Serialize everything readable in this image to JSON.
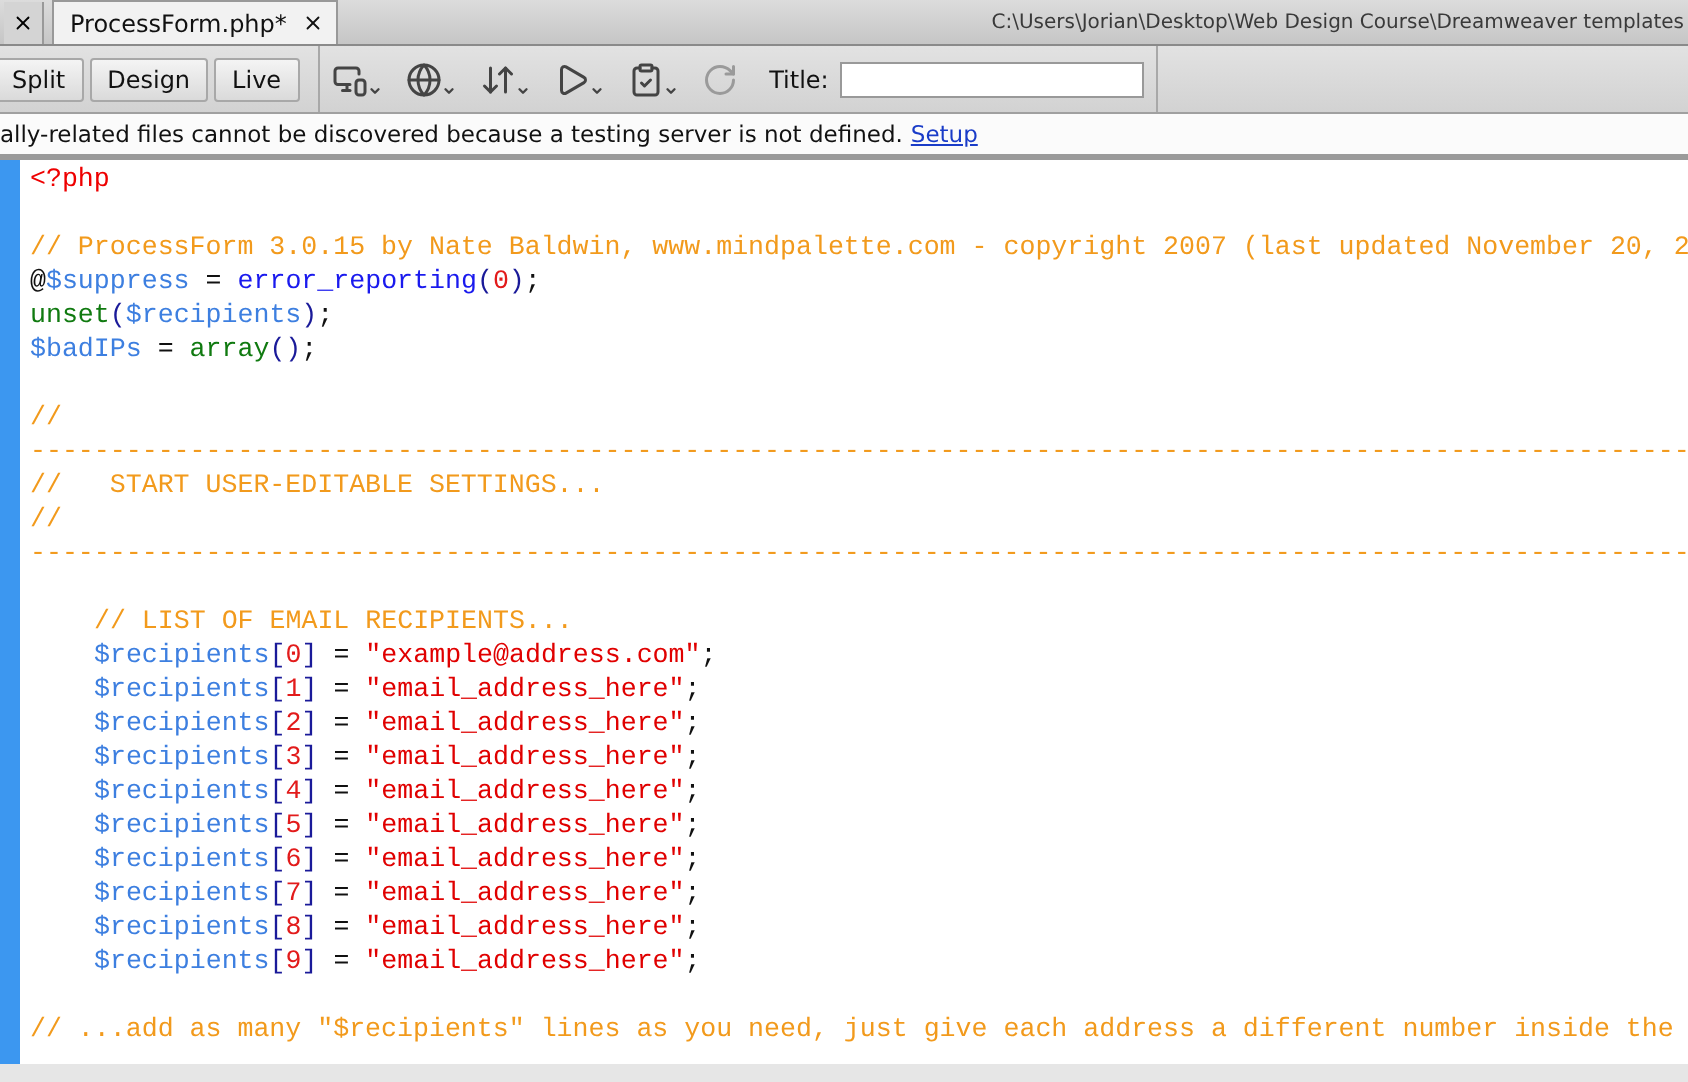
{
  "tabs": [
    {
      "label": "ProcessForm.php*",
      "selected": true
    }
  ],
  "file_path": "C:\\Users\\Jorian\\Desktop\\Web Design Course\\Dreamweaver templates",
  "view_buttons": [
    "Split",
    "Design",
    "Live"
  ],
  "toolbar_icons": [
    {
      "kind": "devices"
    },
    {
      "kind": "globe"
    },
    {
      "kind": "transfer"
    },
    {
      "kind": "visual-aids"
    },
    {
      "kind": "check-page"
    },
    {
      "kind": "refresh",
      "disabled": true
    }
  ],
  "title_field": {
    "label": "Title:"
  },
  "info_bar": {
    "message": "ally-related files cannot be discovered because a testing server is not defined.",
    "link": "Setup"
  },
  "code_blocks": [
    [
      {
        "tokens": [
          {
            "kind": "tag",
            "text": "<?php"
          }
        ]
      }
    ],
    [
      {
        "tokens": [
          {
            "kind": "comment",
            "text": "// ProcessForm 3.0.15 by Nate Baldwin, www.mindpalette.com - copyright 2007 (last updated November 20, 2"
          }
        ]
      },
      {
        "tokens": [
          {
            "kind": "plain",
            "text": "@"
          },
          {
            "kind": "variable",
            "text": "$suppress"
          },
          {
            "kind": "plain",
            "text": " = "
          },
          {
            "kind": "function",
            "text": "error_reporting"
          },
          {
            "kind": "bracket",
            "text": "("
          },
          {
            "kind": "number",
            "text": "0"
          },
          {
            "kind": "bracket",
            "text": ")"
          },
          {
            "kind": "plain",
            "text": ";"
          }
        ]
      },
      {
        "tokens": [
          {
            "kind": "builtin",
            "text": "unset"
          },
          {
            "kind": "bracket",
            "text": "("
          },
          {
            "kind": "variable",
            "text": "$recipients"
          },
          {
            "kind": "bracket",
            "text": ")"
          },
          {
            "kind": "plain",
            "text": ";"
          }
        ]
      },
      {
        "tokens": [
          {
            "kind": "variable",
            "text": "$badIPs"
          },
          {
            "kind": "plain",
            "text": " = "
          },
          {
            "kind": "builtin",
            "text": "array"
          },
          {
            "kind": "bracket",
            "text": "()"
          },
          {
            "kind": "plain",
            "text": ";"
          }
        ]
      }
    ],
    [
      {
        "tokens": [
          {
            "kind": "comment",
            "text": "//"
          }
        ]
      },
      {
        "tokens": [
          {
            "kind": "comment",
            "text": "--------------------------------------------------------------------------------------------------------"
          }
        ]
      },
      {
        "tokens": [
          {
            "kind": "comment",
            "text": "//   START USER-EDITABLE SETTINGS..."
          }
        ]
      },
      {
        "tokens": [
          {
            "kind": "comment",
            "text": "//"
          }
        ]
      },
      {
        "tokens": [
          {
            "kind": "comment",
            "text": "--------------------------------------------------------------------------------------------------------"
          }
        ]
      }
    ],
    [
      {
        "indent": true,
        "tokens": [
          {
            "kind": "comment",
            "text": "// LIST OF EMAIL RECIPIENTS..."
          }
        ]
      },
      {
        "indent": true,
        "tokens": [
          {
            "kind": "variable",
            "text": "$recipients"
          },
          {
            "kind": "bracket",
            "text": "["
          },
          {
            "kind": "number",
            "text": "0"
          },
          {
            "kind": "bracket",
            "text": "]"
          },
          {
            "kind": "plain",
            "text": " = "
          },
          {
            "kind": "string",
            "text": "\"example@address.com\""
          },
          {
            "kind": "plain",
            "text": ";"
          }
        ]
      },
      {
        "indent": true,
        "tokens": [
          {
            "kind": "variable",
            "text": "$recipients"
          },
          {
            "kind": "bracket",
            "text": "["
          },
          {
            "kind": "number",
            "text": "1"
          },
          {
            "kind": "bracket",
            "text": "]"
          },
          {
            "kind": "plain",
            "text": " = "
          },
          {
            "kind": "string",
            "text": "\"email_address_here\""
          },
          {
            "kind": "plain",
            "text": ";"
          }
        ]
      },
      {
        "indent": true,
        "tokens": [
          {
            "kind": "variable",
            "text": "$recipients"
          },
          {
            "kind": "bracket",
            "text": "["
          },
          {
            "kind": "number",
            "text": "2"
          },
          {
            "kind": "bracket",
            "text": "]"
          },
          {
            "kind": "plain",
            "text": " = "
          },
          {
            "kind": "string",
            "text": "\"email_address_here\""
          },
          {
            "kind": "plain",
            "text": ";"
          }
        ]
      },
      {
        "indent": true,
        "tokens": [
          {
            "kind": "variable",
            "text": "$recipients"
          },
          {
            "kind": "bracket",
            "text": "["
          },
          {
            "kind": "number",
            "text": "3"
          },
          {
            "kind": "bracket",
            "text": "]"
          },
          {
            "kind": "plain",
            "text": " = "
          },
          {
            "kind": "string",
            "text": "\"email_address_here\""
          },
          {
            "kind": "plain",
            "text": ";"
          }
        ]
      },
      {
        "indent": true,
        "tokens": [
          {
            "kind": "variable",
            "text": "$recipients"
          },
          {
            "kind": "bracket",
            "text": "["
          },
          {
            "kind": "number",
            "text": "4"
          },
          {
            "kind": "bracket",
            "text": "]"
          },
          {
            "kind": "plain",
            "text": " = "
          },
          {
            "kind": "string",
            "text": "\"email_address_here\""
          },
          {
            "kind": "plain",
            "text": ";"
          }
        ]
      },
      {
        "indent": true,
        "tokens": [
          {
            "kind": "variable",
            "text": "$recipients"
          },
          {
            "kind": "bracket",
            "text": "["
          },
          {
            "kind": "number",
            "text": "5"
          },
          {
            "kind": "bracket",
            "text": "]"
          },
          {
            "kind": "plain",
            "text": " = "
          },
          {
            "kind": "string",
            "text": "\"email_address_here\""
          },
          {
            "kind": "plain",
            "text": ";"
          }
        ]
      },
      {
        "indent": true,
        "tokens": [
          {
            "kind": "variable",
            "text": "$recipients"
          },
          {
            "kind": "bracket",
            "text": "["
          },
          {
            "kind": "number",
            "text": "6"
          },
          {
            "kind": "bracket",
            "text": "]"
          },
          {
            "kind": "plain",
            "text": " = "
          },
          {
            "kind": "string",
            "text": "\"email_address_here\""
          },
          {
            "kind": "plain",
            "text": ";"
          }
        ]
      },
      {
        "indent": true,
        "tokens": [
          {
            "kind": "variable",
            "text": "$recipients"
          },
          {
            "kind": "bracket",
            "text": "["
          },
          {
            "kind": "number",
            "text": "7"
          },
          {
            "kind": "bracket",
            "text": "]"
          },
          {
            "kind": "plain",
            "text": " = "
          },
          {
            "kind": "string",
            "text": "\"email_address_here\""
          },
          {
            "kind": "plain",
            "text": ";"
          }
        ]
      },
      {
        "indent": true,
        "tokens": [
          {
            "kind": "variable",
            "text": "$recipients"
          },
          {
            "kind": "bracket",
            "text": "["
          },
          {
            "kind": "number",
            "text": "8"
          },
          {
            "kind": "bracket",
            "text": "]"
          },
          {
            "kind": "plain",
            "text": " = "
          },
          {
            "kind": "string",
            "text": "\"email_address_here\""
          },
          {
            "kind": "plain",
            "text": ";"
          }
        ]
      },
      {
        "indent": true,
        "tokens": [
          {
            "kind": "variable",
            "text": "$recipients"
          },
          {
            "kind": "bracket",
            "text": "["
          },
          {
            "kind": "number",
            "text": "9"
          },
          {
            "kind": "bracket",
            "text": "]"
          },
          {
            "kind": "plain",
            "text": " = "
          },
          {
            "kind": "string",
            "text": "\"email_address_here\""
          },
          {
            "kind": "plain",
            "text": ";"
          }
        ]
      }
    ],
    [
      {
        "tokens": [
          {
            "kind": "comment",
            "text": "// ...add as many \"$recipients\" lines as you need, just give each address a different number inside the"
          }
        ]
      }
    ]
  ]
}
